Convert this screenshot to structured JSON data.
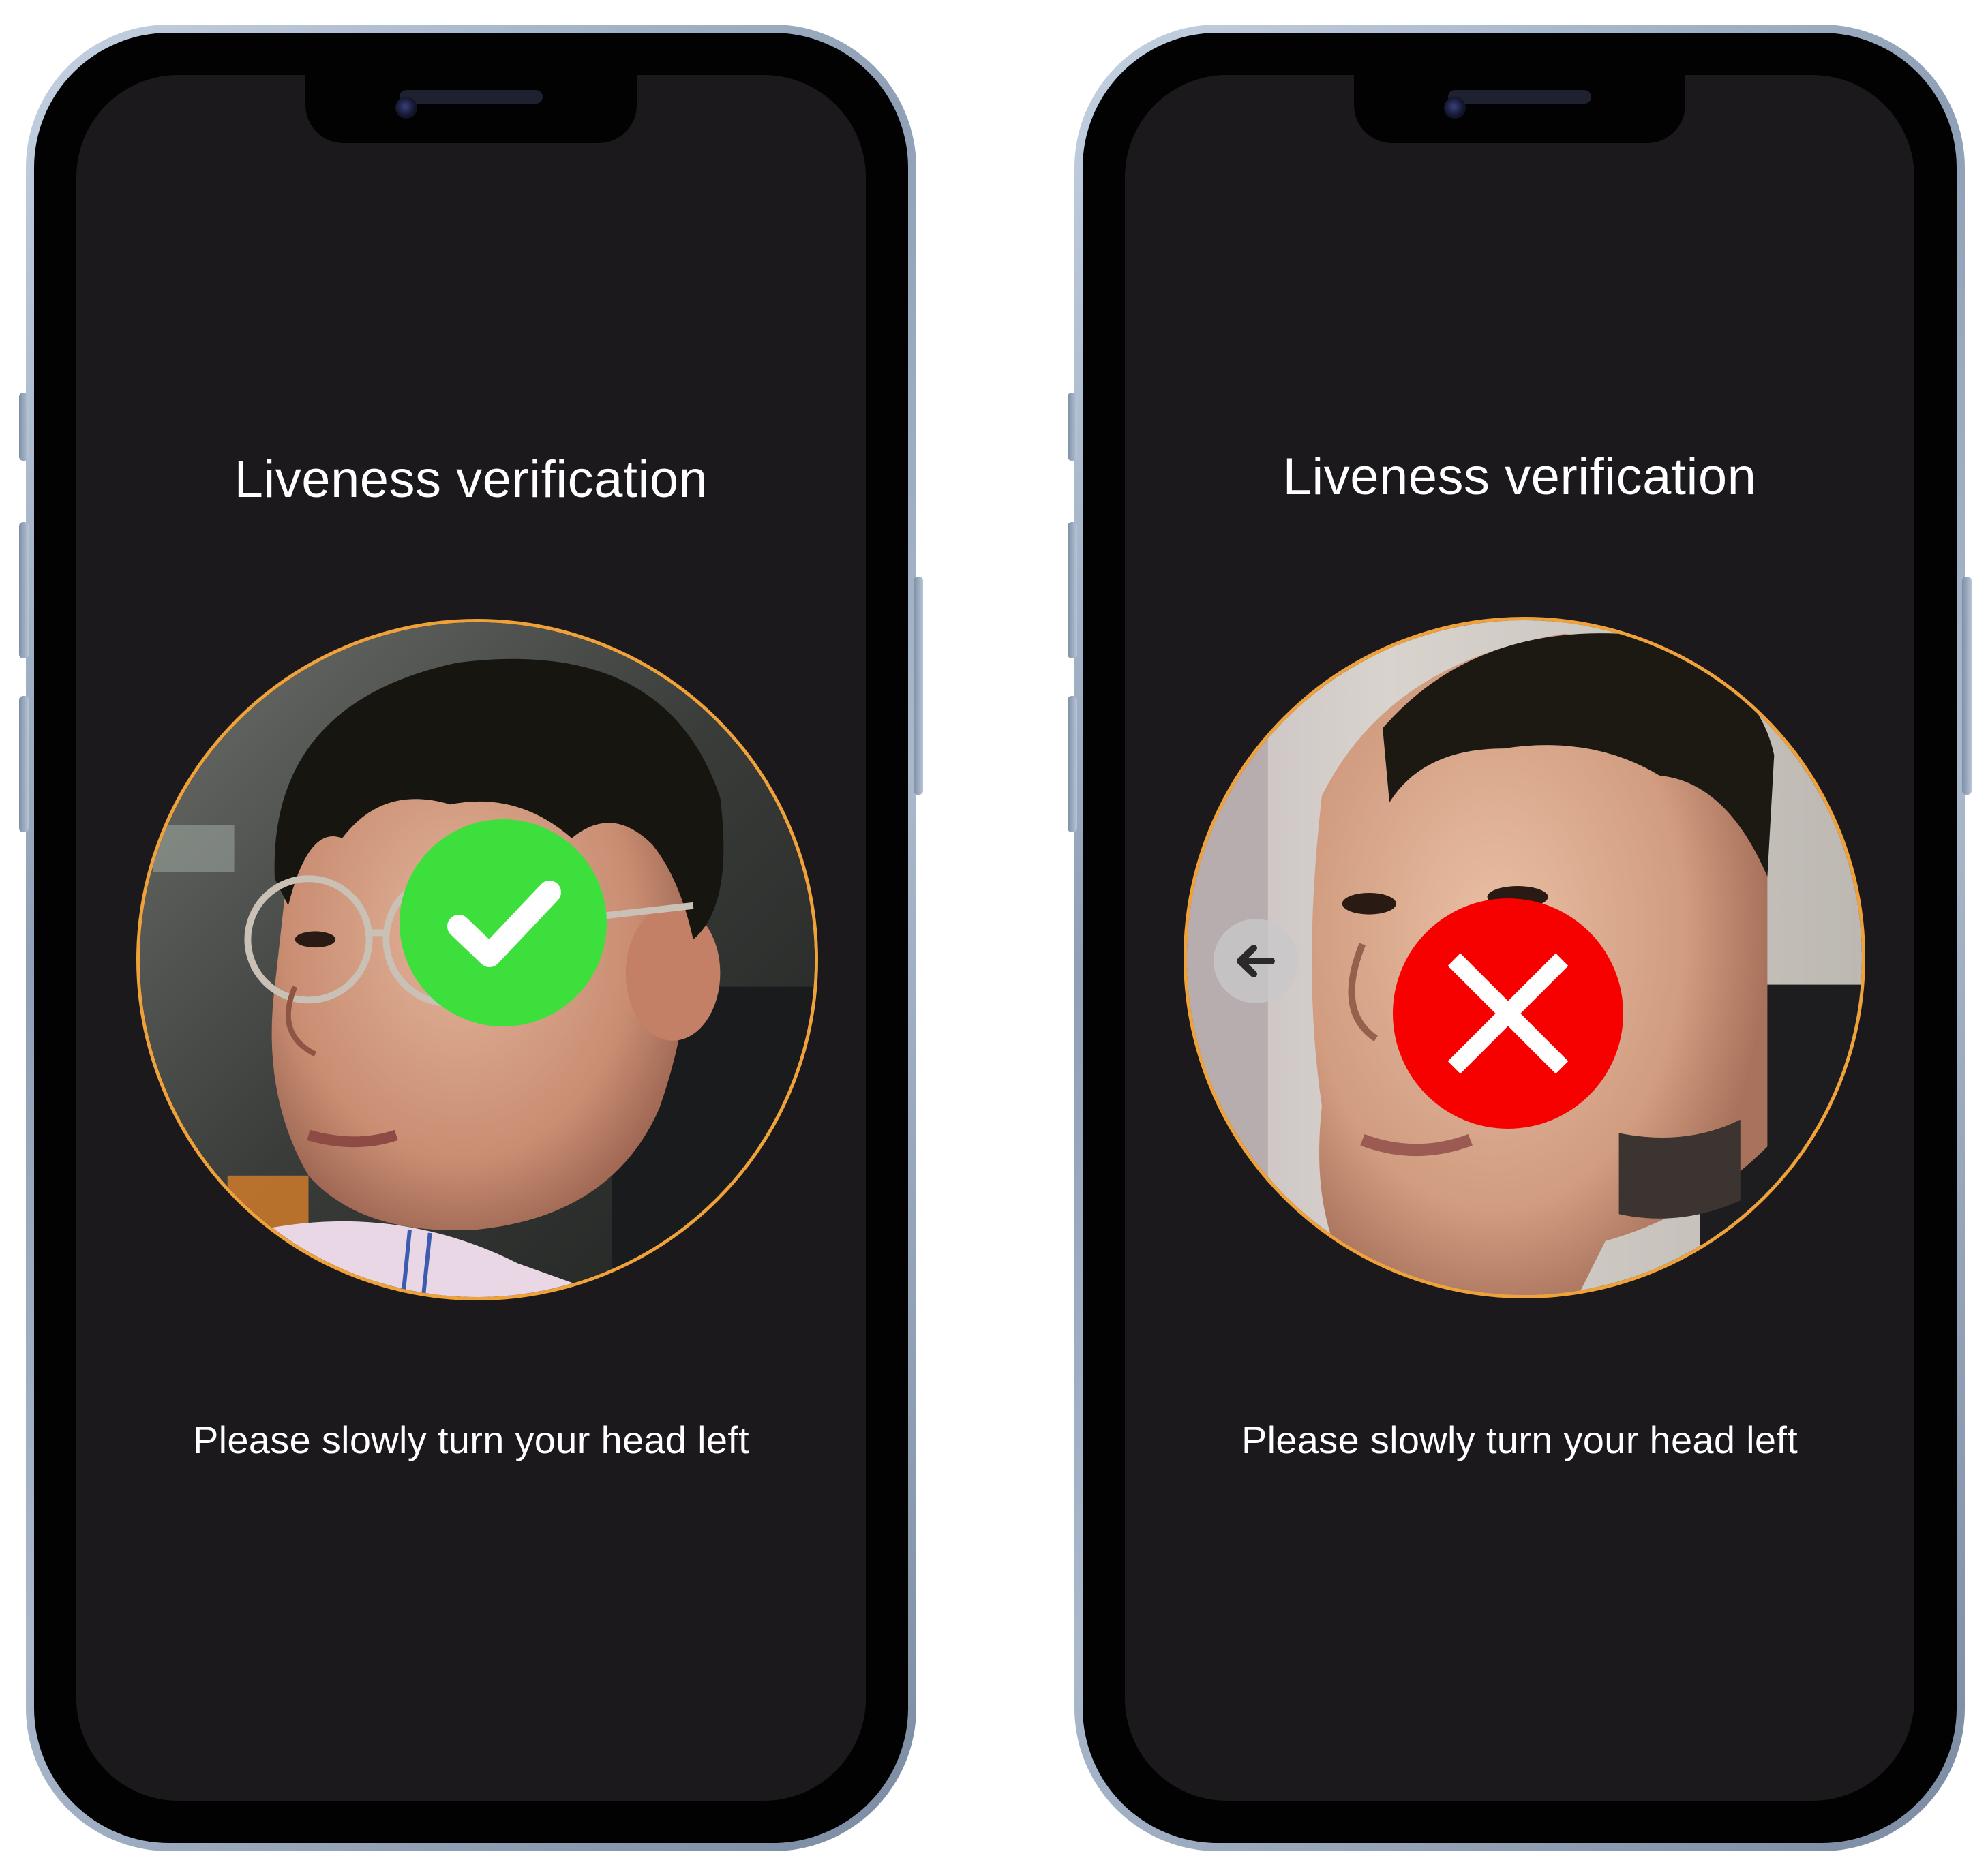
{
  "screens": [
    {
      "title": "Liveness verification",
      "instruction": "Please slowly turn your head left",
      "result": "pass",
      "result_color": "#3ddf3d",
      "ring_color": "#f0a23a",
      "status_icon": "checkmark-icon"
    },
    {
      "title": "Liveness verification",
      "instruction": "Please slowly turn your head left",
      "result": "fail",
      "result_color": "#f70000",
      "ring_color": "#f0a23a",
      "status_icon": "x-mark-icon",
      "hint_icon": "arrow-left-icon"
    }
  ],
  "colors": {
    "screen_background": "#1b191c",
    "text": "#ffffff"
  }
}
